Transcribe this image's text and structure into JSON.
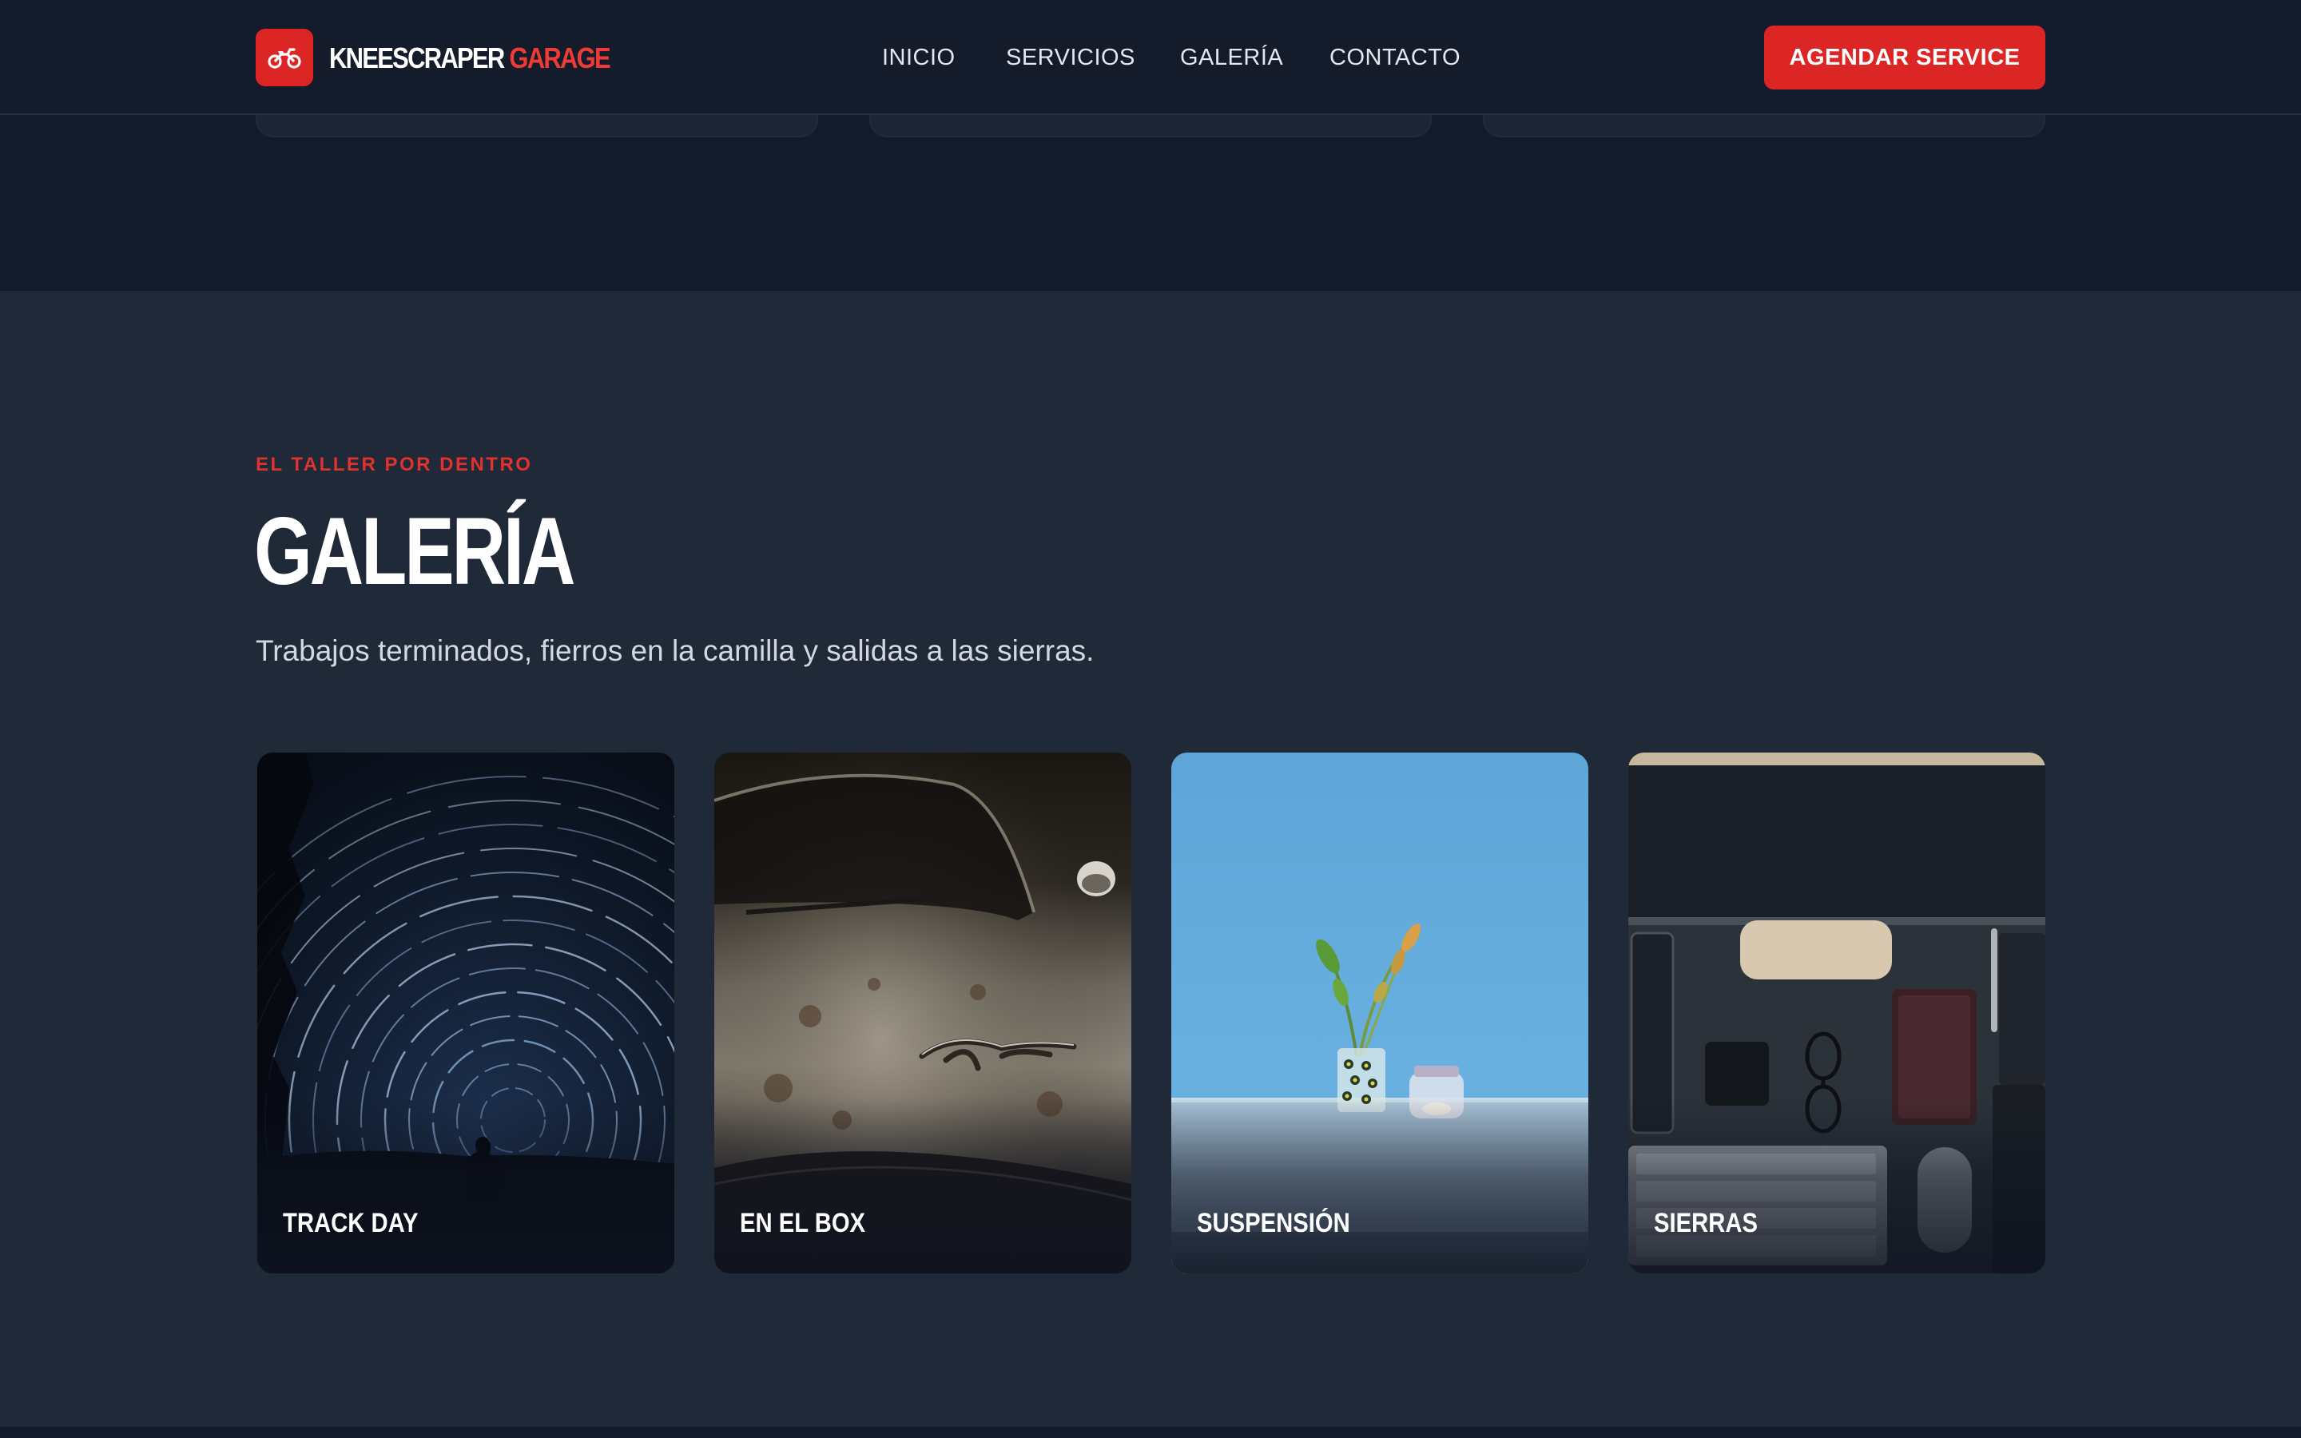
{
  "brand": {
    "name_part1": "KNEESCRAPER",
    "name_part2": "GARAGE",
    "logo_icon": "motorcycle-icon",
    "accent_color": "#dc2626"
  },
  "nav": {
    "items": [
      {
        "label": "INICIO"
      },
      {
        "label": "SERVICIOS"
      },
      {
        "label": "GALERÍA"
      },
      {
        "label": "CONTACTO"
      }
    ],
    "cta_label": "AGENDAR SERVICE"
  },
  "gallery": {
    "eyebrow": "EL TALLER POR DENTRO",
    "title": "GALERÍA",
    "subtitle": "Trabajos terminados, fierros en la camilla y salidas a las sierras.",
    "items": [
      {
        "caption": "TRACK DAY"
      },
      {
        "caption": "EN EL BOX"
      },
      {
        "caption": "SUSPENSIÓN"
      },
      {
        "caption": "SIERRAS"
      }
    ]
  }
}
